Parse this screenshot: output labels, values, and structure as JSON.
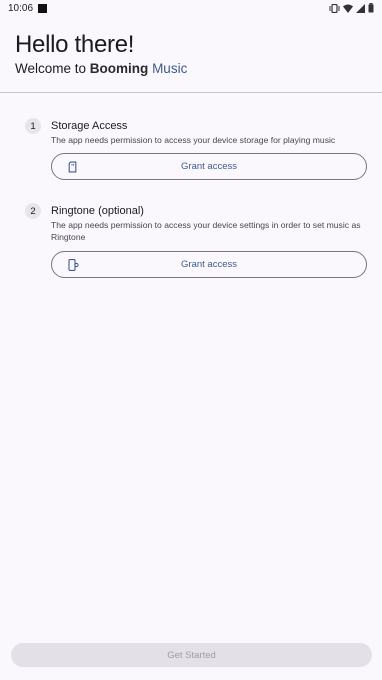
{
  "status_bar": {
    "time": "10:06",
    "icons": [
      "notification-square-icon",
      "vibrate-icon",
      "wifi-icon",
      "signal-icon",
      "battery-icon"
    ]
  },
  "header": {
    "title": "Hello there!",
    "subtitle_prefix": "Welcome to",
    "brand_bold": "Booming",
    "brand_accent": "Music"
  },
  "steps": [
    {
      "number": "1",
      "title": "Storage Access",
      "description": "The app needs permission to access your device storage for playing music",
      "button_label": "Grant access",
      "button_icon": "sd-card-icon"
    },
    {
      "number": "2",
      "title": "Ringtone (optional)",
      "description": "The app needs permission to access your device settings in order to set music as Ringtone",
      "button_label": "Grant access",
      "button_icon": "phone-settings-icon"
    }
  ],
  "footer": {
    "get_started_label": "Get Started"
  },
  "colors": {
    "background": "#fbf8fd",
    "accent": "#3d5a8a",
    "disabled_button": "#e3e1e7"
  }
}
